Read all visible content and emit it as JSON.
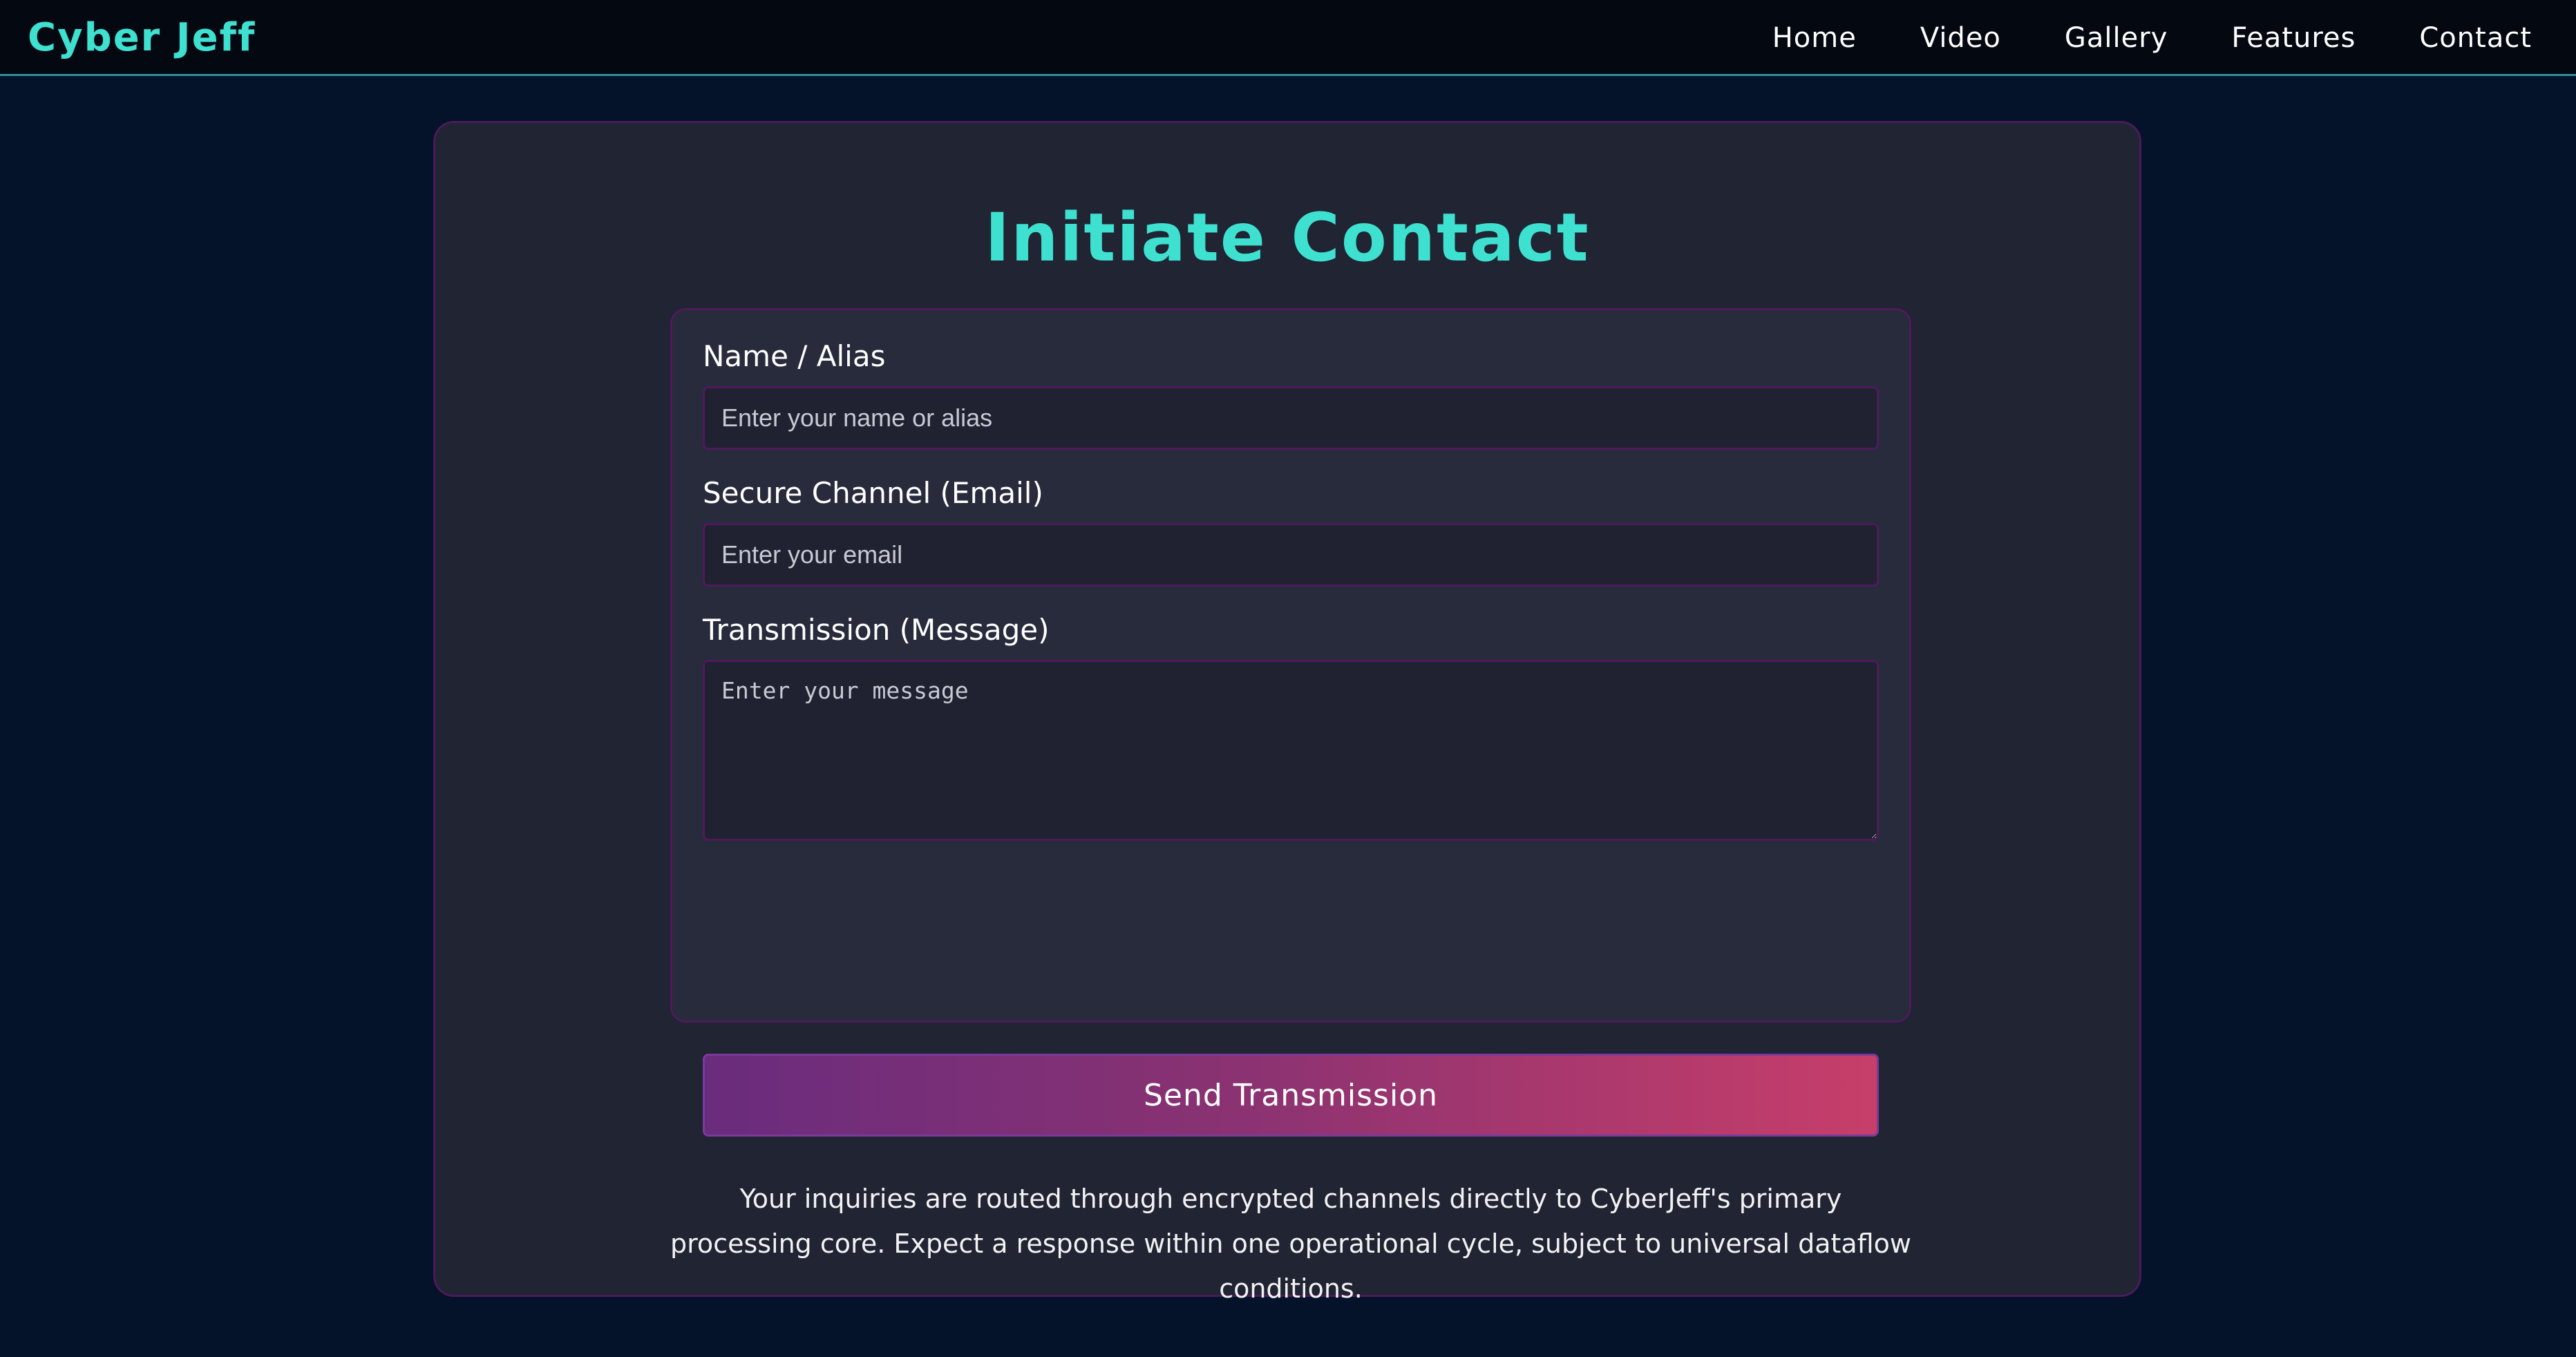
{
  "header": {
    "brand": "Cyber Jeff",
    "nav": [
      {
        "label": "Home"
      },
      {
        "label": "Video"
      },
      {
        "label": "Gallery"
      },
      {
        "label": "Features"
      },
      {
        "label": "Contact"
      }
    ]
  },
  "contact": {
    "title": "Initiate Contact",
    "name_label": "Name / Alias",
    "name_placeholder": "Enter your name or alias",
    "email_label": "Secure Channel (Email)",
    "email_placeholder": "Enter your email",
    "message_label": "Transmission (Message)",
    "message_placeholder": "Enter your message",
    "submit_label": "Send Transmission",
    "info": "Your inquiries are routed through encrypted channels directly to CyberJeff's primary processing core. Expect a response within one operational cycle, subject to universal dataflow conditions."
  },
  "colors": {
    "accent": "#3ee0d0",
    "background": "#04122a",
    "card": "#202433",
    "border": "#4e1a5c",
    "button_gradient_start": "#6a2c7d",
    "button_gradient_end": "#c73e6a"
  }
}
